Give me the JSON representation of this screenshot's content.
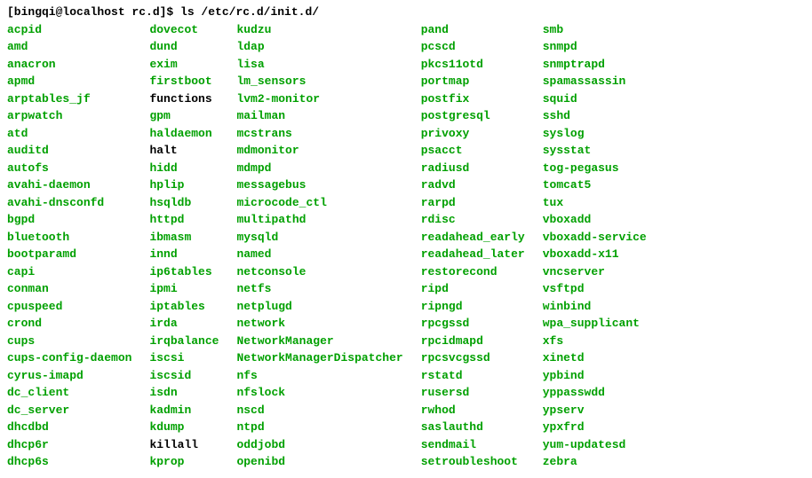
{
  "prompt": "[bingqi@localhost rc.d]$ ls /etc/rc.d/init.d/",
  "columns": [
    [
      "acpid",
      "amd",
      "anacron",
      "apmd",
      "arptables_jf",
      "arpwatch",
      "atd",
      "auditd",
      "autofs",
      "avahi-daemon",
      "avahi-dnsconfd",
      "bgpd",
      "bluetooth",
      "bootparamd",
      "capi",
      "conman",
      "cpuspeed",
      "crond",
      "cups",
      "cups-config-daemon",
      "cyrus-imapd",
      "dc_client",
      "dc_server",
      "dhcdbd",
      "dhcp6r",
      "dhcp6s"
    ],
    [
      "dovecot",
      "dund",
      "exim",
      "firstboot",
      "functions",
      "gpm",
      "haldaemon",
      "halt",
      "hidd",
      "hplip",
      "hsqldb",
      "httpd",
      "ibmasm",
      "innd",
      "ip6tables",
      "ipmi",
      "iptables",
      "irda",
      "irqbalance",
      "iscsi",
      "iscsid",
      "isdn",
      "kadmin",
      "kdump",
      "killall",
      "kprop"
    ],
    [
      "kudzu",
      "ldap",
      "lisa",
      "lm_sensors",
      "lvm2-monitor",
      "mailman",
      "mcstrans",
      "mdmonitor",
      "mdmpd",
      "messagebus",
      "microcode_ctl",
      "multipathd",
      "mysqld",
      "named",
      "netconsole",
      "netfs",
      "netplugd",
      "network",
      "NetworkManager",
      "NetworkManagerDispatcher",
      "nfs",
      "nfslock",
      "nscd",
      "ntpd",
      "oddjobd",
      "openibd"
    ],
    [
      "pand",
      "pcscd",
      "pkcs11otd",
      "portmap",
      "postfix",
      "postgresql",
      "privoxy",
      "psacct",
      "radiusd",
      "radvd",
      "rarpd",
      "rdisc",
      "readahead_early",
      "readahead_later",
      "restorecond",
      "ripd",
      "ripngd",
      "rpcgssd",
      "rpcidmapd",
      "rpcsvcgssd",
      "rstatd",
      "rusersd",
      "rwhod",
      "saslauthd",
      "sendmail",
      "setroubleshoot"
    ],
    [
      "smb",
      "snmpd",
      "snmptrapd",
      "spamassassin",
      "squid",
      "sshd",
      "syslog",
      "sysstat",
      "tog-pegasus",
      "tomcat5",
      "tux",
      "vboxadd",
      "vboxadd-service",
      "vboxadd-x11",
      "vncserver",
      "vsftpd",
      "winbind",
      "wpa_supplicant",
      "xfs",
      "xinetd",
      "ypbind",
      "yppasswdd",
      "ypserv",
      "ypxfrd",
      "yum-updatesd",
      "zebra"
    ]
  ],
  "plain_files": [
    "functions",
    "halt",
    "killall"
  ]
}
